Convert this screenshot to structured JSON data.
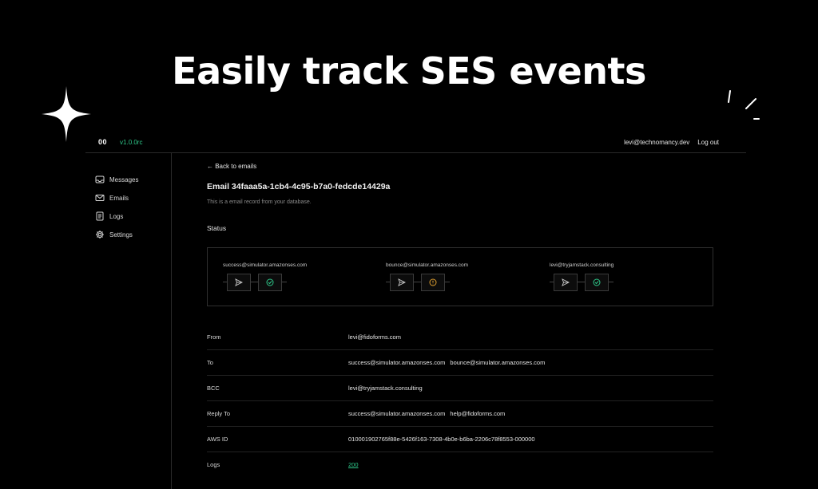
{
  "hero": {
    "title": "Easily track SES events"
  },
  "topbar": {
    "brand": "00",
    "version": "v1.0.0rc",
    "user_email": "levi@technomancy.dev",
    "logout_label": "Log out"
  },
  "sidebar": {
    "items": [
      {
        "label": "Messages",
        "icon": "inbox-icon"
      },
      {
        "label": "Emails",
        "icon": "envelope-icon"
      },
      {
        "label": "Logs",
        "icon": "list-icon"
      },
      {
        "label": "Settings",
        "icon": "gear-icon"
      }
    ]
  },
  "main": {
    "back_label": "← Back to emails",
    "title": "Email 34faaa5a-1cb4-4c95-b7a0-fedcde14429a",
    "subtitle": "This is a email record from your database.",
    "status_heading": "Status"
  },
  "status": {
    "recipients": [
      {
        "email": "success@simulator.amazonses.com",
        "result_icon": "check-circle-icon",
        "result_color": "#2fc88a"
      },
      {
        "email": "bounce@simulator.amazonses.com",
        "result_icon": "alert-circle-icon",
        "result_color": "#e0a030"
      },
      {
        "email": "levi@tryjamstack.consulting",
        "result_icon": "check-circle-icon",
        "result_color": "#2fc88a"
      }
    ]
  },
  "details": {
    "from": {
      "label": "From",
      "value": "levi@fidoforms.com"
    },
    "to": {
      "label": "To",
      "values": [
        "success@simulator.amazonses.com",
        "bounce@simulator.amazonses.com"
      ]
    },
    "bcc": {
      "label": "BCC",
      "value": "levi@tryjamstack.consulting"
    },
    "reply_to": {
      "label": "Reply To",
      "values": [
        "success@simulator.amazonses.com",
        "help@fidoforms.com"
      ]
    },
    "aws_id": {
      "label": "AWS ID",
      "value": "010001902765f88e-5426f163-7308-4b0e-b6ba-2206c78f8553-000000"
    },
    "logs": {
      "label": "Logs",
      "value": "200"
    }
  },
  "colors": {
    "accent": "#2fc88a",
    "warning": "#e0a030",
    "background": "#000000"
  }
}
